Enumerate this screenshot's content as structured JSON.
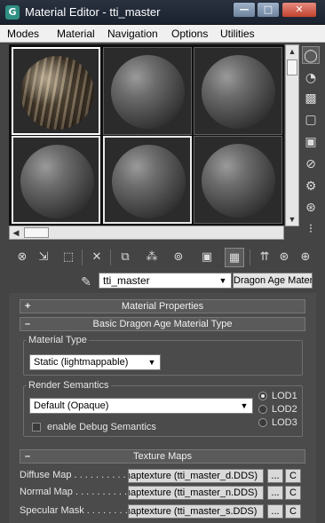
{
  "window": {
    "title": "Material Editor - tti_master",
    "app_icon_letter": "G",
    "buttons": {
      "minimize": "—",
      "maximize": "□",
      "close": "✕"
    }
  },
  "menu": [
    "Modes",
    "Material",
    "Navigation",
    "Options",
    "Utilities"
  ],
  "slots": [
    {
      "type": "textured",
      "state": "active"
    },
    {
      "type": "default",
      "state": "normal"
    },
    {
      "type": "default",
      "state": "normal"
    },
    {
      "type": "default",
      "state": "selected"
    },
    {
      "type": "default",
      "state": "normal"
    },
    {
      "type": "default",
      "state": "normal"
    }
  ],
  "side_toolbar_icons": [
    "sample-type-icon",
    "backlight-icon",
    "background-icon",
    "sample-uv-tiling-icon",
    "video-color-check-icon",
    "make-preview-icon",
    "options-icon",
    "select-by-material-icon",
    "material-map-navigator-icon"
  ],
  "bottom_toolbar_icons": [
    "get-material-icon",
    "put-to-scene-icon",
    "assign-to-selection-icon",
    "reset-map-icon",
    "make-unique-icon",
    "put-to-library-icon",
    "material-id-channel-icon",
    "show-shaded-in-viewport-icon",
    "show-end-result-icon",
    "go-to-parent-icon",
    "go-forward-to-sibling-icon",
    "go-to-sibling-icon"
  ],
  "material": {
    "name": "tti_master",
    "type_button": "Dragon Age Material"
  },
  "rollouts": {
    "material_properties": {
      "sign": "+",
      "title": "Material Properties"
    },
    "basic_type": {
      "sign": "–",
      "title": "Basic Dragon Age Material Type"
    },
    "texture_maps": {
      "sign": "–",
      "title": "Texture Maps"
    }
  },
  "material_type": {
    "label": "Material Type",
    "value": "Static (lightmappable)"
  },
  "render_semantics": {
    "label": "Render Semantics",
    "value": "Default (Opaque)",
    "lods": [
      "LOD1",
      "LOD2",
      "LOD3"
    ],
    "selected_lod": "LOD1",
    "debug_checkbox_label": "enable Debug Semantics",
    "debug_checked": false
  },
  "texture_maps": [
    {
      "label": "Diffuse Map . . . . . . . . . . .",
      "value": "Bitmaptexture (tti_master_d.DDS)",
      "dots": "...",
      "c": "C"
    },
    {
      "label": "Normal Map . . . . . . . . . . .",
      "value": "Bitmaptexture (tti_master_n.DDS)",
      "dots": "...",
      "c": "C"
    },
    {
      "label": "Specular Mask . . . . . . . . .",
      "value": "Bitmaptexture (tti_master_s.DDS)",
      "dots": "...",
      "c": "C"
    }
  ]
}
